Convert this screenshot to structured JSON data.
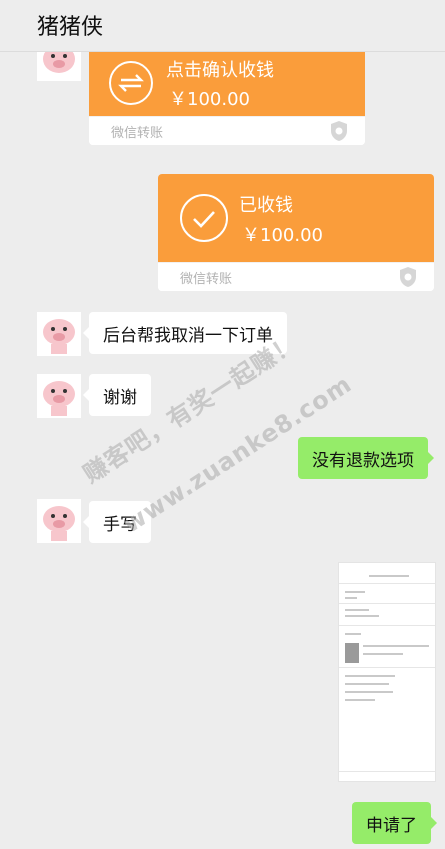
{
  "header": {
    "title": "猪猪侠"
  },
  "transfer1": {
    "action": "点击确认收钱",
    "amount": "￥100.00",
    "footer": "微信转账"
  },
  "transfer2": {
    "action": "已收钱",
    "amount": "￥100.00",
    "footer": "微信转账"
  },
  "messages": [
    {
      "side": "left",
      "text": "后台帮我取消一下订单"
    },
    {
      "side": "left",
      "text": "谢谢"
    },
    {
      "side": "right",
      "text": "没有退款选项"
    },
    {
      "side": "left",
      "text": "手写"
    },
    {
      "side": "right",
      "text": "申请了"
    }
  ],
  "watermark": {
    "line1": "赚客吧，有奖一起赚！",
    "line2": "www.zuanke8.com"
  },
  "colors": {
    "transfer_orange": "#fa9d3b",
    "bubble_green": "#95ec69",
    "background": "#ededed"
  }
}
